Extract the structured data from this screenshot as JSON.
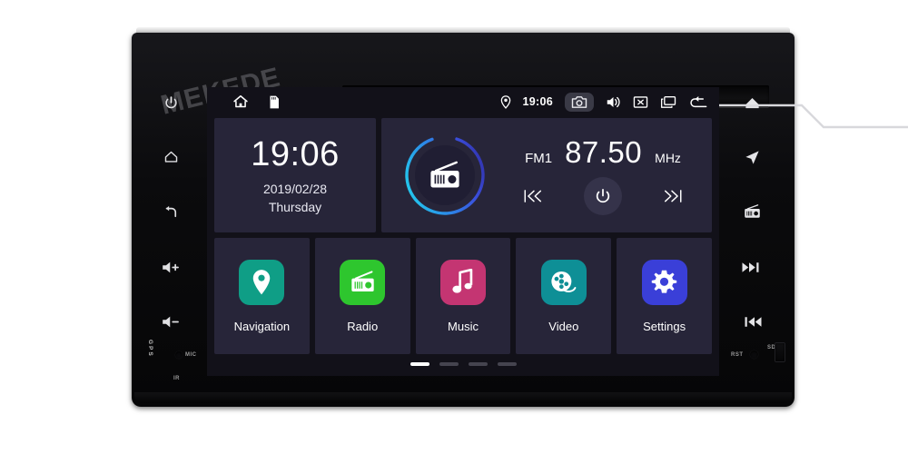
{
  "device": {
    "brand_watermark": "MEKEDE",
    "left_bezel": {
      "buttons": [
        {
          "name": "power-button",
          "icon": "power-icon"
        },
        {
          "name": "home-button",
          "icon": "home-icon"
        },
        {
          "name": "back-button",
          "icon": "back-arrow-icon"
        },
        {
          "name": "volume-up-button",
          "icon": "volume-up-icon"
        },
        {
          "name": "volume-down-button",
          "icon": "volume-down-icon"
        }
      ],
      "gps_label": "GPS",
      "mic_label": "MIC",
      "ir_label": "IR"
    },
    "right_bezel": {
      "buttons": [
        {
          "name": "eject-button",
          "icon": "eject-icon"
        },
        {
          "name": "navigation-button",
          "icon": "nav-arrow-icon"
        },
        {
          "name": "radio-button",
          "icon": "radio-icon"
        },
        {
          "name": "next-track-button",
          "icon": "next-track-icon"
        },
        {
          "name": "prev-track-button",
          "icon": "prev-track-icon"
        }
      ],
      "reset_label": "RST",
      "sd_label": "SD"
    }
  },
  "statusbar": {
    "home_icon": "home-icon",
    "sdcard_icon": "sd-card-icon",
    "location_icon": "location-pin-icon",
    "time": "19:06",
    "camera_icon": "camera-icon",
    "volume_icon": "speaker-icon",
    "close_icon": "close-box-icon",
    "recents_icon": "recent-apps-icon",
    "back_icon": "back-arrow-icon"
  },
  "clock_widget": {
    "time": "19:06",
    "date": "2019/02/28",
    "weekday": "Thursday"
  },
  "radio_widget": {
    "icon": "radio-icon",
    "band": "FM1",
    "frequency": "87.50",
    "unit": "MHz",
    "prev_icon": "skip-previous-icon",
    "power_icon": "power-icon",
    "next_icon": "skip-next-icon",
    "ring_color_start": "#22d3ee",
    "ring_color_end": "#3b3fd8"
  },
  "apps": [
    {
      "label": "Navigation",
      "icon": "location-pin-icon",
      "color": "#0f9e86"
    },
    {
      "label": "Radio",
      "icon": "radio-icon",
      "color": "#2ec62e"
    },
    {
      "label": "Music",
      "icon": "music-note-icon",
      "color": "#c43572"
    },
    {
      "label": "Video",
      "icon": "film-reel-icon",
      "color": "#0e8f96"
    },
    {
      "label": "Settings",
      "icon": "gear-icon",
      "color": "#3a3fd8"
    }
  ],
  "page_indicator": {
    "total": 4,
    "active": 1
  },
  "colors": {
    "screen_bg": "#121119",
    "tile_bg": "#272539",
    "accent": "#22d3ee"
  }
}
